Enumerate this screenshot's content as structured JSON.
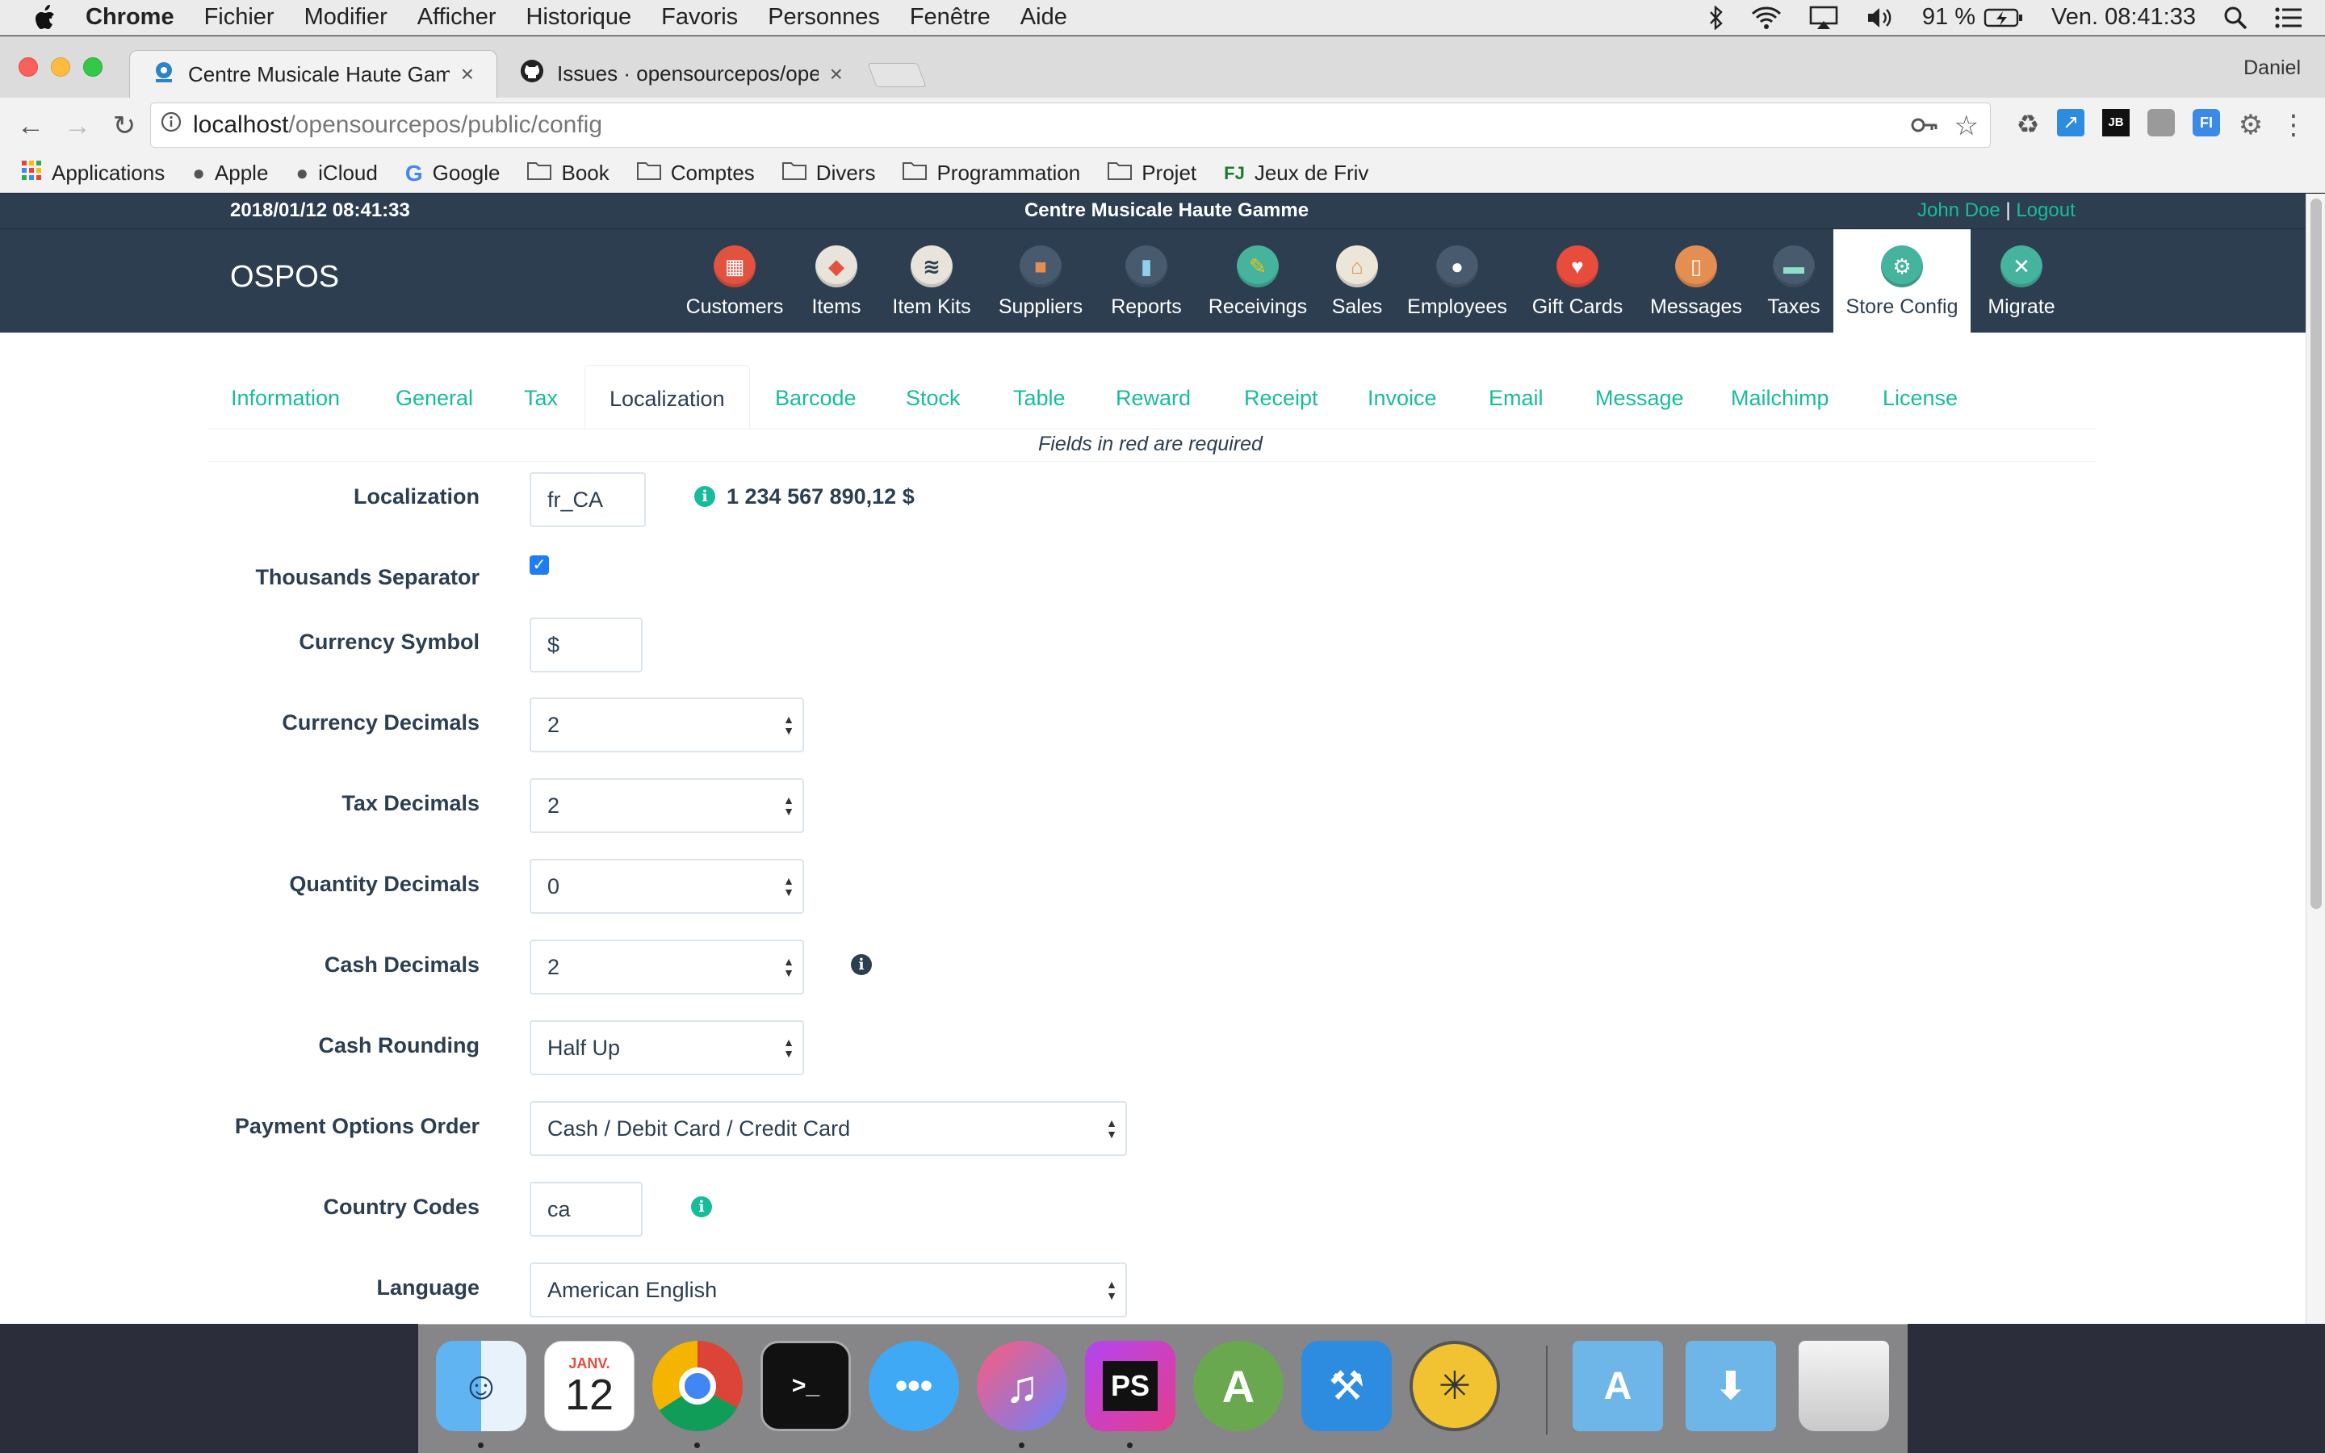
{
  "menubar": {
    "items": [
      "Chrome",
      "Fichier",
      "Modifier",
      "Afficher",
      "Historique",
      "Favoris",
      "Personnes",
      "Fenêtre",
      "Aide"
    ],
    "battery": "91 %",
    "clock": "Ven. 08:41:33"
  },
  "browser": {
    "tabs": [
      {
        "title": "Centre Musicale Haute Gamme"
      },
      {
        "title": "Issues · opensourcepos/opens"
      }
    ],
    "profile": "Daniel",
    "url_host": "localhost",
    "url_path": "/opensourcepos/public/config",
    "bookmarks": [
      "Applications",
      "Apple",
      "iCloud",
      "Google",
      "Book",
      "Comptes",
      "Divers",
      "Programmation",
      "Projet",
      "Jeux de Friv"
    ]
  },
  "app": {
    "datetime": "2018/01/12 08:41:33",
    "store_name": "Centre Musicale Haute Gamme",
    "user_name": "John Doe",
    "user_sep": "|",
    "logout": "Logout",
    "brand": "OSPOS",
    "nav": [
      {
        "label": "Customers",
        "icon": "customers-icon",
        "color": "#e2533f"
      },
      {
        "label": "Items",
        "icon": "items-icon",
        "color": "#e8e4dc"
      },
      {
        "label": "Item Kits",
        "icon": "item-kits-icon",
        "color": "#e8e4dc"
      },
      {
        "label": "Suppliers",
        "icon": "suppliers-icon",
        "color": "#485a6e"
      },
      {
        "label": "Reports",
        "icon": "reports-icon",
        "color": "#485a6e"
      },
      {
        "label": "Receivings",
        "icon": "receivings-icon",
        "color": "#45b39d"
      },
      {
        "label": "Sales",
        "icon": "sales-icon",
        "color": "#ece6d8"
      },
      {
        "label": "Employees",
        "icon": "employees-icon",
        "color": "#485a6e"
      },
      {
        "label": "Gift Cards",
        "icon": "gift-cards-icon",
        "color": "#e74c3c"
      },
      {
        "label": "Messages",
        "icon": "messages-icon",
        "color": "#e58e52"
      },
      {
        "label": "Taxes",
        "icon": "taxes-icon",
        "color": "#485a6e"
      },
      {
        "label": "Store Config",
        "icon": "store-config-icon",
        "color": "#45b39d"
      },
      {
        "label": "Migrate",
        "icon": "migrate-icon",
        "color": "#45b39d"
      }
    ],
    "config_tabs": [
      "Information",
      "General",
      "Tax",
      "Localization",
      "Barcode",
      "Stock",
      "Table",
      "Reward",
      "Receipt",
      "Invoice",
      "Email",
      "Message",
      "Mailchimp",
      "License"
    ],
    "active_tab": "Localization",
    "required_note": "Fields in red are required",
    "form": {
      "localization": {
        "label": "Localization",
        "value": "fr_CA",
        "sample": "1 234 567 890,12 $"
      },
      "thousands_separator": {
        "label": "Thousands Separator",
        "checked": true
      },
      "currency_symbol": {
        "label": "Currency Symbol",
        "value": "$"
      },
      "currency_decimals": {
        "label": "Currency Decimals",
        "value": "2"
      },
      "tax_decimals": {
        "label": "Tax Decimals",
        "value": "2"
      },
      "quantity_decimals": {
        "label": "Quantity Decimals",
        "value": "0"
      },
      "cash_decimals": {
        "label": "Cash Decimals",
        "value": "2"
      },
      "cash_rounding": {
        "label": "Cash Rounding",
        "value": "Half Up"
      },
      "payment_options_order": {
        "label": "Payment Options Order",
        "value": "Cash / Debit Card / Credit Card"
      },
      "country_codes": {
        "label": "Country Codes",
        "value": "ca"
      },
      "language": {
        "label": "Language",
        "value": "American English"
      }
    }
  },
  "dock": {
    "calendar_month": "JANV.",
    "calendar_day": "12"
  },
  "colors": {
    "navy": "#2c3e50",
    "teal": "#18bc9c"
  }
}
